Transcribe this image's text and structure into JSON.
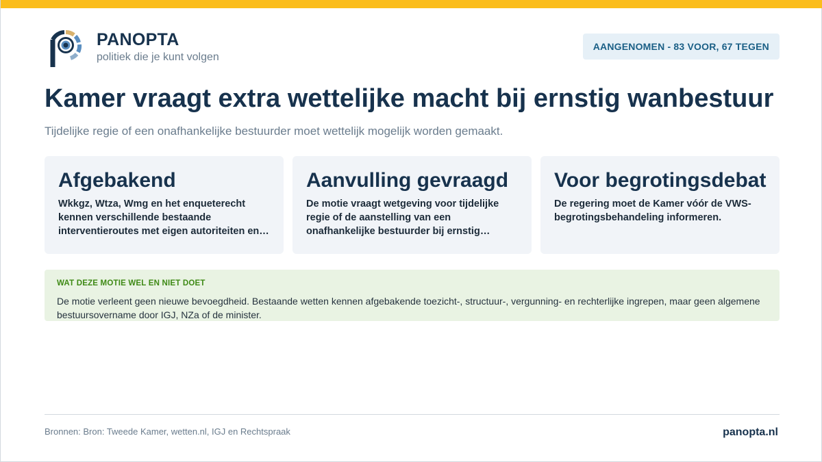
{
  "brand": {
    "name": "PANOPTA",
    "tagline": "politiek die je kunt volgen",
    "colors": {
      "accent": "#fbbd1c",
      "navy": "#17324d",
      "ring_blue": "#5a8ec0",
      "ring_gold": "#d8b26e"
    },
    "logo_icon": "panopta-eye-logo-icon"
  },
  "status": {
    "label": "AANGENOMEN - 83 VOOR, 67 TEGEN"
  },
  "headline": {
    "title": "Kamer vraagt extra wettelijke macht bij ernstig wanbestuur",
    "subtitle": "Tijdelijke regie of een onafhankelijke bestuurder moet wettelijk mogelijk worden gemaakt."
  },
  "cards": [
    {
      "title": "Afgebakend",
      "text": "Wkkgz, Wtza, Wmg en het enqueterecht kennen verschillende bestaande interventieroutes met eigen autoriteiten en voorwaarden."
    },
    {
      "title": "Aanvulling gevraagd",
      "text": "De motie vraagt wetgeving voor tijdelijke regie of de aanstelling van een onafhankelijke bestuurder bij ernstig wanbestuur."
    },
    {
      "title": "Voor begrotingsdebat",
      "text": "De regering moet de Kamer vóór de VWS-begrotingsbehandeling informeren."
    }
  ],
  "note": {
    "heading": "WAT DEZE MOTIE WEL EN NIET DOET",
    "text": "De motie verleent geen nieuwe bevoegdheid. Bestaande wetten kennen afgebakende toezicht-, structuur-, vergunning- en rechterlijke ingrepen, maar geen algemene bestuursovername door IGJ, NZa of de minister."
  },
  "footer": {
    "sources": "Bronnen: Bron: Tweede Kamer, wetten.nl, IGJ en Rechtspraak",
    "url": "panopta.nl"
  }
}
